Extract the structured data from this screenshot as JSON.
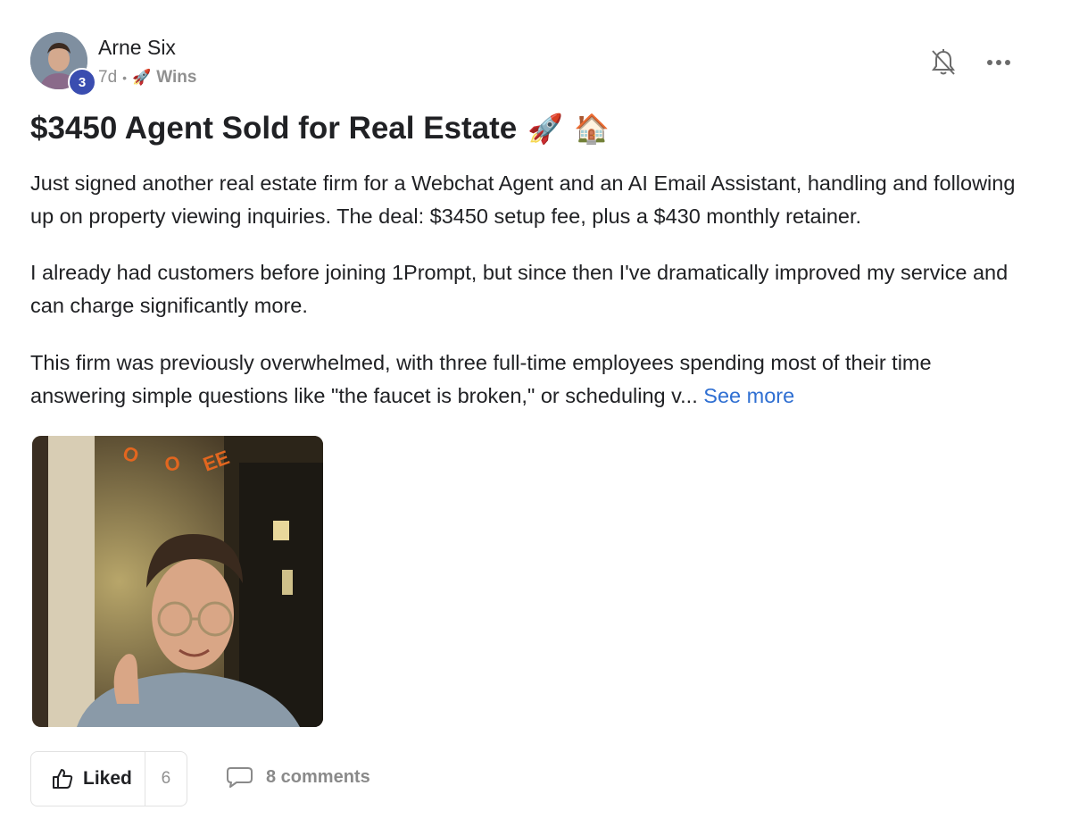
{
  "post": {
    "author": {
      "name": "Arne Six",
      "level": "3"
    },
    "meta": {
      "age": "7d",
      "separator": "•",
      "category_emoji": "🚀",
      "category": "Wins"
    },
    "title": "$3450 Agent Sold for Real Estate",
    "title_emojis": [
      "🚀",
      "🏠"
    ],
    "paragraphs": [
      "Just signed another real estate firm for a Webchat Agent and an AI Email Assistant, handling and following up on property viewing inquiries. The deal: $3450 setup fee, plus a $430 monthly retainer.",
      "I already had customers before joining 1Prompt, but since then I've dramatically improved my service and can charge significantly more.",
      "This firm was previously overwhelmed, with three full-time employees spending most of their time answering simple questions like \"the faucet is broken,\" or scheduling v..."
    ],
    "see_more_label": "See more",
    "actions": {
      "like_label": "Liked",
      "like_count": "6",
      "comments_label": "8 comments"
    }
  },
  "icons": {
    "bell": "bell-off-icon",
    "more": "more-horizontal-icon",
    "like": "thumbs-up-icon",
    "comment": "comment-icon"
  },
  "colors": {
    "link": "#2f6fd2",
    "badge": "#3a4db0",
    "muted": "#909090"
  }
}
